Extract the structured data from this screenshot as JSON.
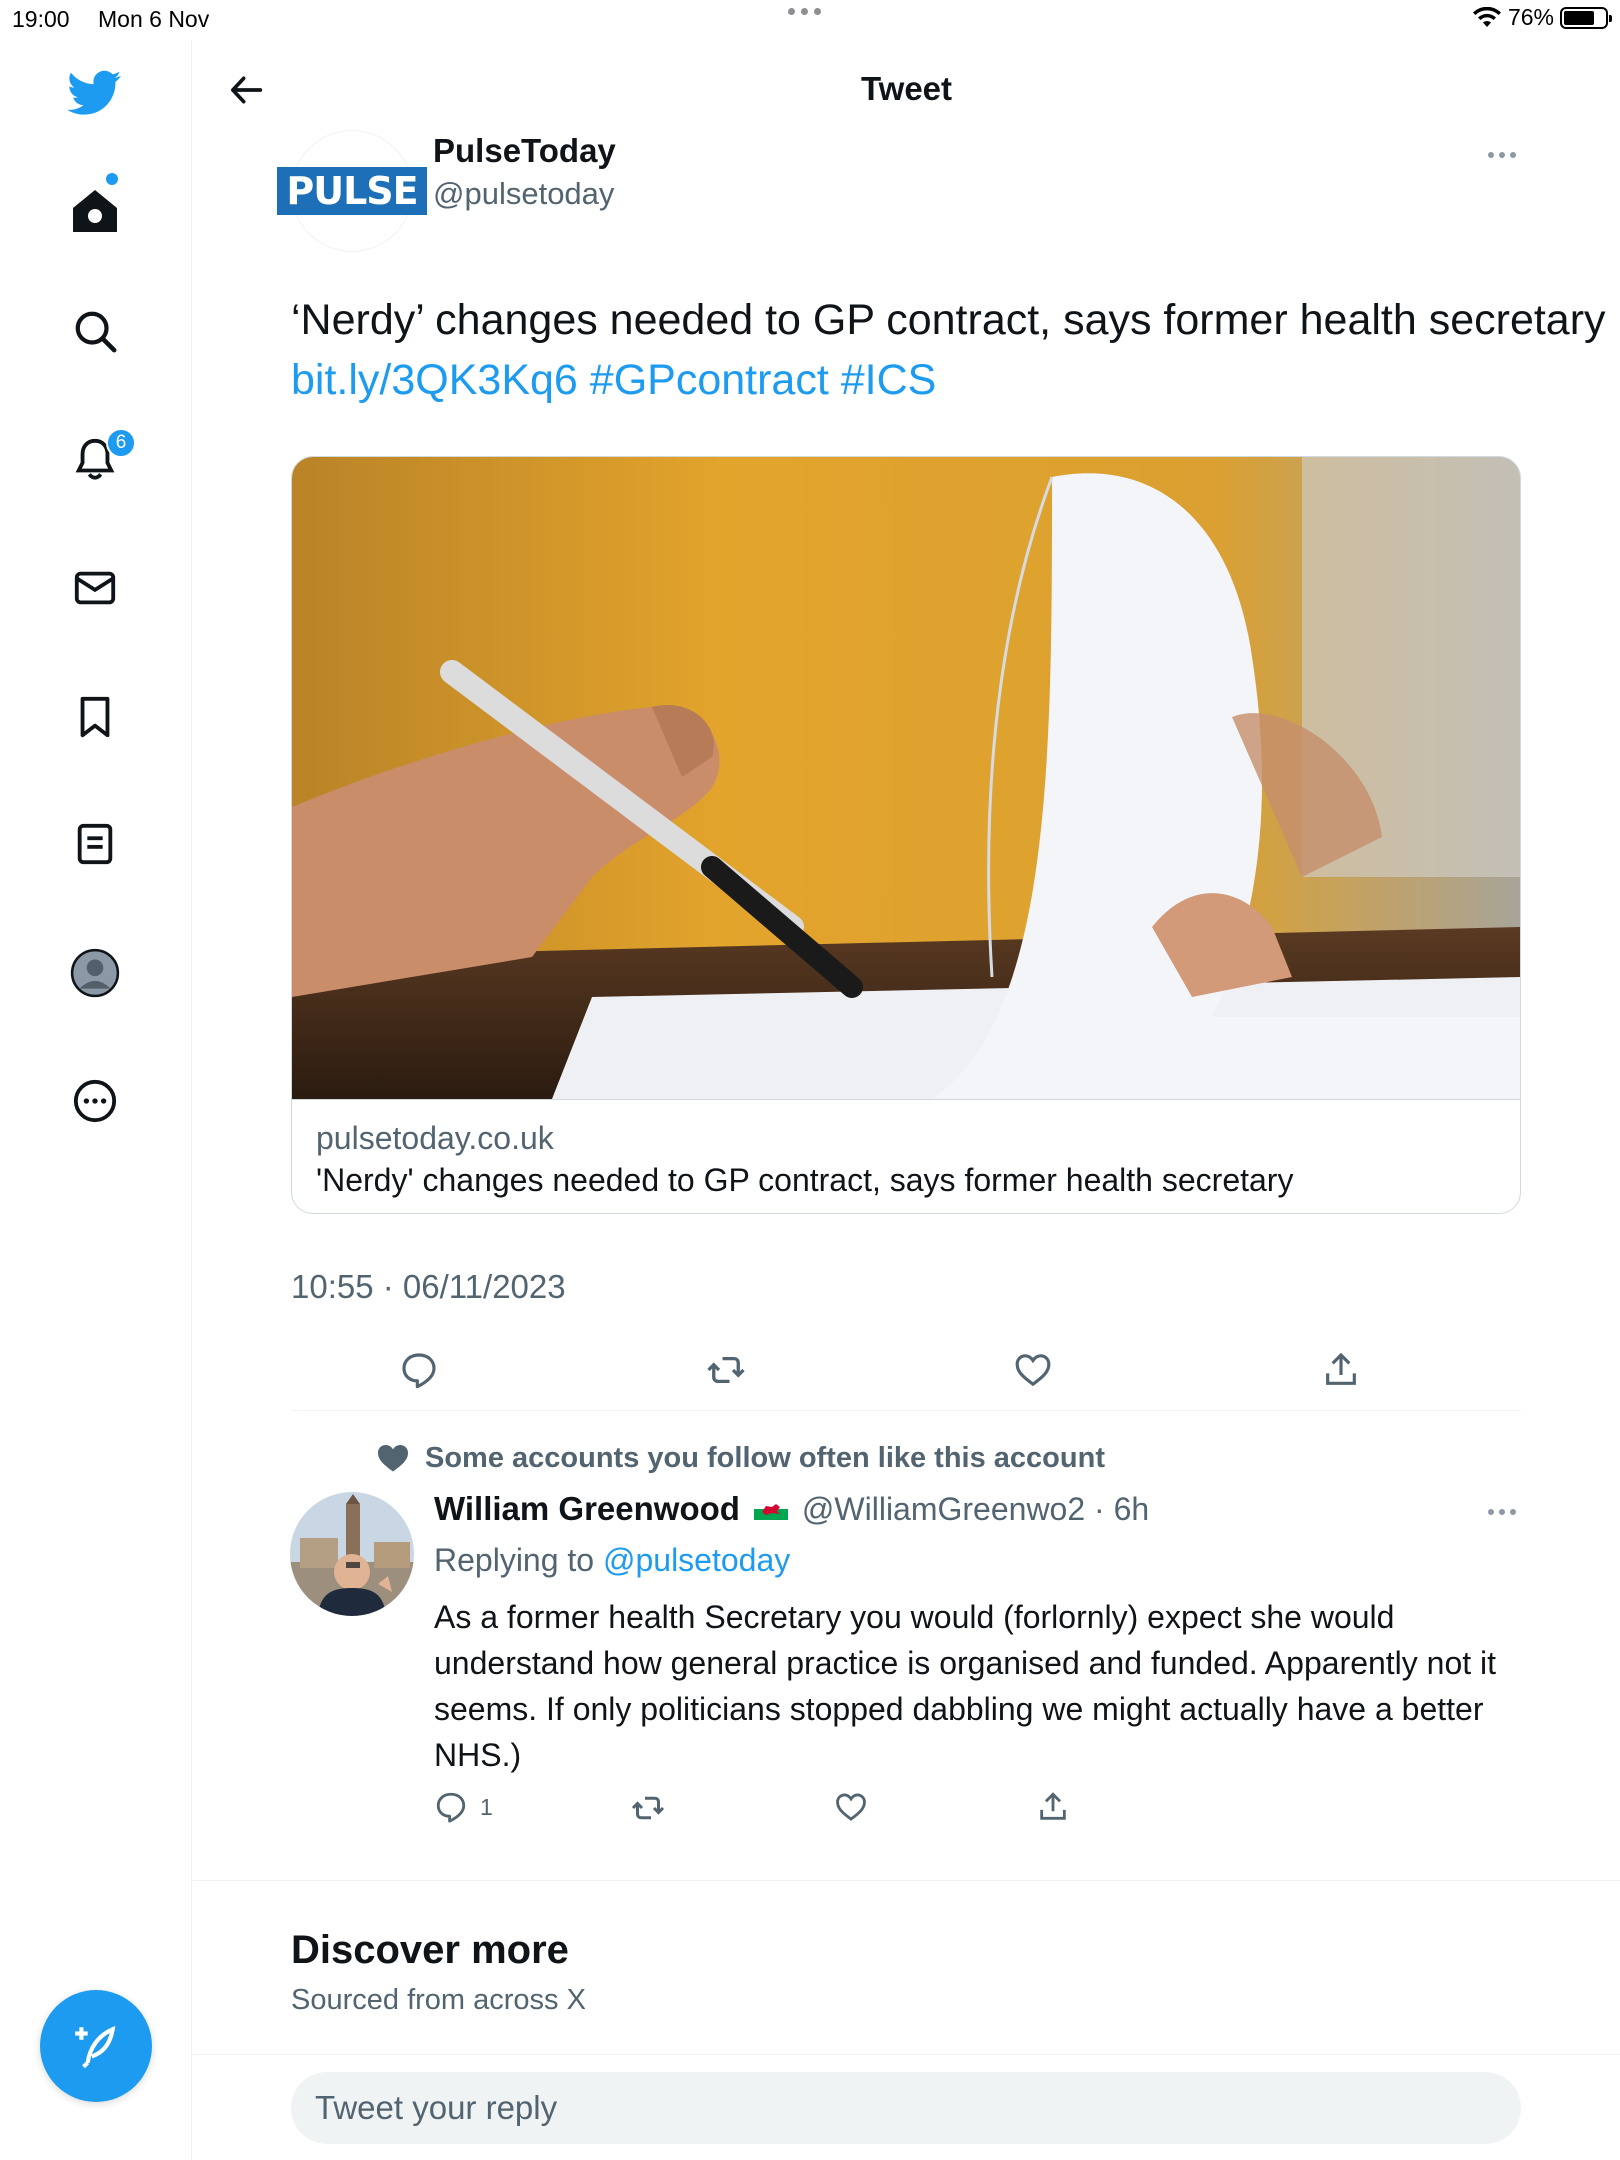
{
  "status_bar": {
    "time": "19:00",
    "date": "Mon 6 Nov",
    "battery": "76%",
    "battery_level": 0.76
  },
  "header": {
    "title": "Tweet"
  },
  "sidebar": {
    "notification_count": "6"
  },
  "tweet": {
    "author_name": "PulseToday",
    "author_handle": "@pulsetoday",
    "avatar_logo_text": "PULSE",
    "text_plain": "‘Nerdy’ changes needed to GP contract, says former health secretary ",
    "link": "bit.ly/3QK3Kq6",
    "hashtag1": "#GPcontract",
    "hashtag2": "#ICS",
    "card_domain": "pulsetoday.co.uk",
    "card_title": "'Nerdy' changes needed to GP contract, says former health secretary",
    "timestamp": "10:55 · 06/11/2023"
  },
  "reply": {
    "social_context": "Some accounts you follow often like this account",
    "name": "William Greenwood",
    "handle_time": "@WilliamGreenwo2 · 6h",
    "replying_label": "Replying to ",
    "replying_mention": "@pulsetoday",
    "text": "As a former health Secretary you would (forlornly) expect she would understand how general practice is organised and funded. Apparently not it seems. If only politicians stopped dabbling we might actually have a better NHS.)",
    "reply_count": "1"
  },
  "discover": {
    "title": "Discover more",
    "subtitle": "Sourced from across X"
  },
  "reply_input": {
    "placeholder": "Tweet your reply"
  },
  "colors": {
    "accent": "#1d9bf0",
    "text": "#0f1419",
    "secondary": "#536471"
  }
}
